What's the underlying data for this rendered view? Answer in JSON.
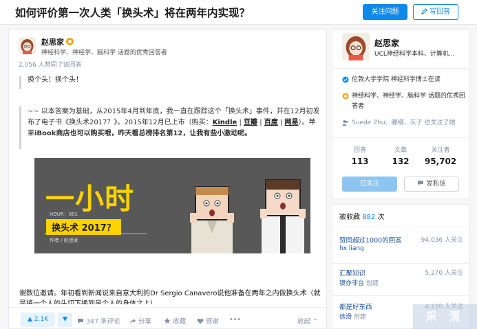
{
  "question": {
    "title": "如何评价第一次人类「换头术」将在两年内实现？",
    "follow_label": "关注问题",
    "write_label": "写回答"
  },
  "answer": {
    "author_name": "赵思家",
    "author_bio": "神经科学、神经学、脑科学 话题的优秀回答者",
    "votes_text": "2,056 人赞同了该回答",
    "quote1": "换个头！换个头！",
    "para1_a": "~~ 以本答案为基础，从2015年4月到年底，我一直在跟踪这个「换头术」事件，并在12月初发布了电子书《换头术2017？》。2015年12月已上市（购买：",
    "link_kindle": "Kindle",
    "sep": " | ",
    "link_douban": "豆瓣",
    "link_baidu": "百度",
    "link_wangyi": "网易",
    "para1_b": "）。苹果",
    "para1_c": "iBook商店也可以购买哦，昨天看总榜排名第12，让我有些小激动呢。",
    "banner": {
      "big": "一小时",
      "hour": "HOUR：001",
      "tag": "换头术 2017？",
      "author": "作者 / 赵思家"
    },
    "text": "谢数位邀请。年初看到新闻说来自意大利的Dr Sergio Canavero说他准备在两年之内做换头术（就是将一个人的头切下换到另个人的身体之上）",
    "actions": {
      "upvote": "▲ 2.1K",
      "downvote": "▼",
      "comments": "347 条评论",
      "share": "分享",
      "collect": "收藏",
      "thanks": "感谢",
      "collapse": "收起 ⌃"
    }
  },
  "sidebar": {
    "name": "赵思家",
    "bio": "UCL神经科学本科、计算机...",
    "verified": "伦敦大学学院 神经科学博士在读",
    "excellence": "神经科学、神经学、脑科学 话题的优秀回答者",
    "followed_by": "Suede Zhu、滕缙、灰子 也关注了她",
    "stats": [
      {
        "label": "回答",
        "value": "113"
      },
      {
        "label": "文章",
        "value": "132"
      },
      {
        "label": "关注者",
        "value": "95,702"
      }
    ],
    "followed_label": "已关注",
    "message_label": "发私信"
  },
  "favorites": {
    "title_prefix": "被收藏 ",
    "count": "882",
    "title_suffix": " 次",
    "items": [
      {
        "name": "赞同超过1000的回答",
        "count": "94,036 人关注",
        "owner": "hx liang",
        "action": ""
      },
      {
        "name": "汇聚知识",
        "count": "5,270 人关注",
        "owner": "镜亦非台",
        "action": " 创建"
      },
      {
        "name": "都是好东西",
        "count": "4,120 人关注",
        "owner": "徐滑",
        "action": " 创建"
      }
    ]
  },
  "watermark": "采 渭",
  "colors": {
    "accent": "#0f88eb",
    "badge": "#f5a623",
    "banner_yellow": "#ffd200"
  }
}
